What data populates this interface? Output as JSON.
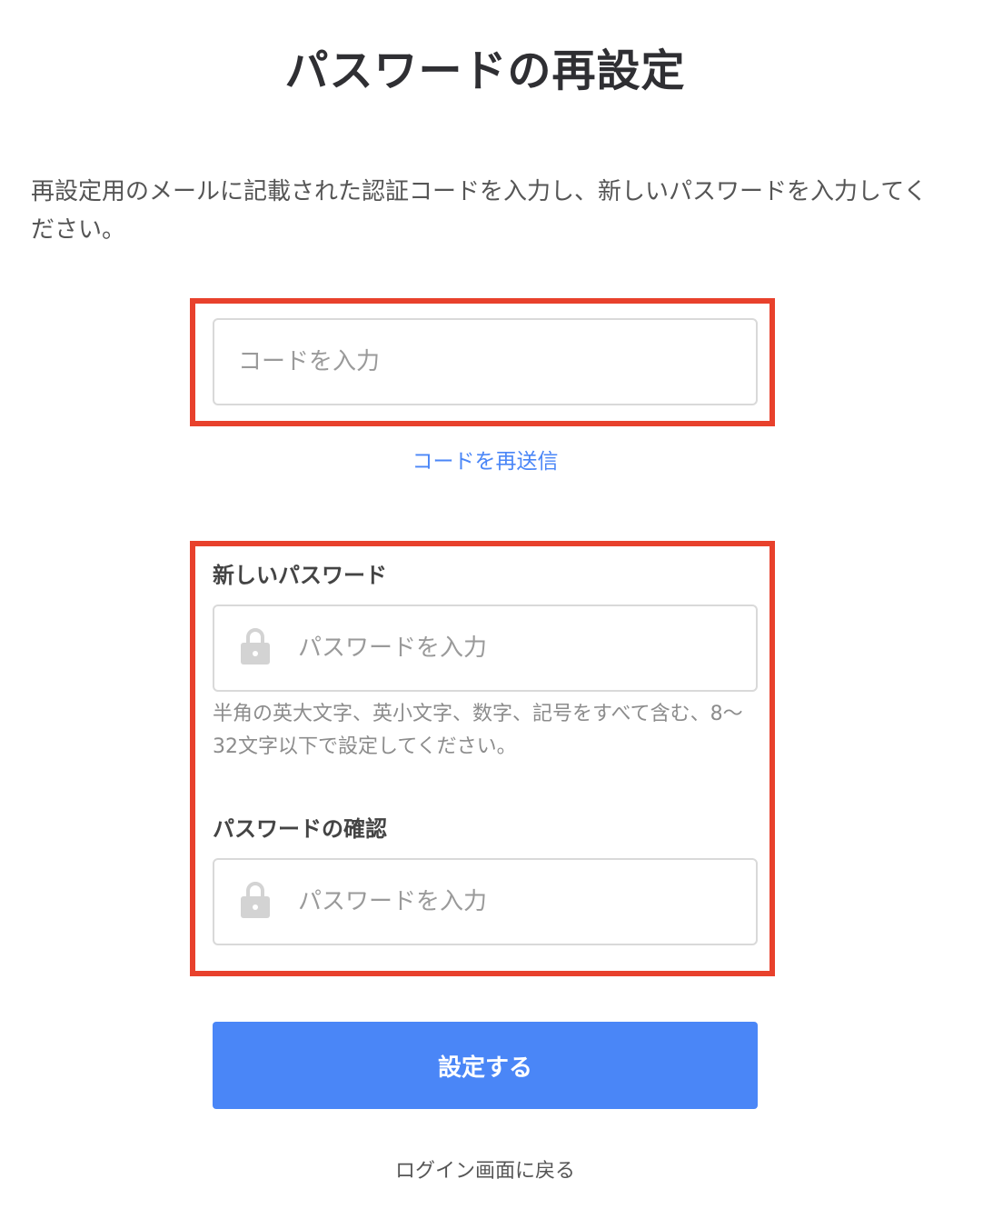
{
  "header": {
    "title": "パスワードの再設定"
  },
  "description": "再設定用のメールに記載された認証コードを入力し、新しいパスワードを入力してください。",
  "code_field": {
    "placeholder": "コードを入力",
    "value": ""
  },
  "resend_link": "コードを再送信",
  "new_password": {
    "label": "新しいパスワード",
    "placeholder": "パスワードを入力",
    "value": "",
    "icon": "lock-icon",
    "hint": "半角の英大文字、英小文字、数字、記号をすべて含む、8〜32文字以下で設定してください。"
  },
  "confirm_password": {
    "label": "パスワードの確認",
    "placeholder": "パスワードを入力",
    "value": "",
    "icon": "lock-icon"
  },
  "submit_button": "設定する",
  "back_link": "ログイン画面に戻る",
  "colors": {
    "accent": "#4a86f7",
    "highlight": "#e8412c",
    "input_border": "#d9d9d9",
    "title_text": "#2f2f33"
  }
}
